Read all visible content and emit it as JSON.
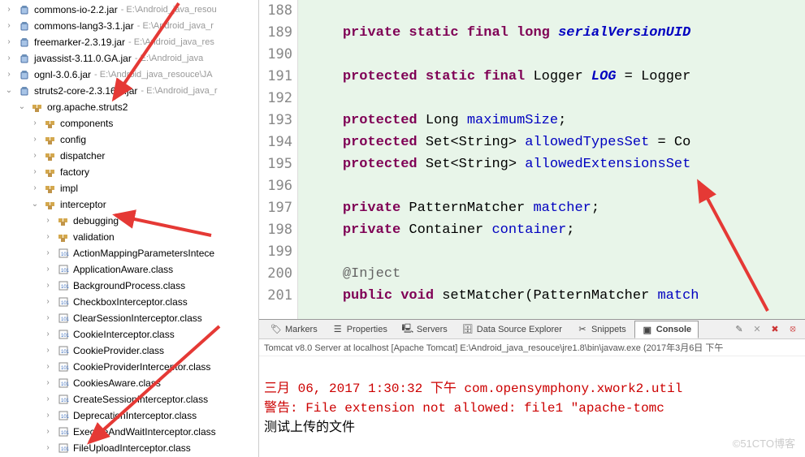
{
  "explorer": {
    "jars": [
      {
        "name": "commons-io-2.2.jar",
        "path": "E:\\Android_java_resou"
      },
      {
        "name": "commons-lang3-3.1.jar",
        "path": "E:\\Android_java_r"
      },
      {
        "name": "freemarker-2.3.19.jar",
        "path": "E:\\Android_java_res"
      },
      {
        "name": "javassist-3.11.0.GA.jar",
        "path": "E:\\Android_java"
      },
      {
        "name": "ognl-3.0.6.jar",
        "path": "E:\\Android_java_resouce\\JA"
      }
    ],
    "expandedJar": {
      "name": "struts2-core-2.3.16.3.jar",
      "path": "E:\\Android_java_r"
    },
    "rootPkg": "org.apache.struts2",
    "subPkgs": [
      "components",
      "config",
      "dispatcher",
      "factory",
      "impl"
    ],
    "openPkg": "interceptor",
    "innerPkgs": [
      "debugging",
      "validation"
    ],
    "classes": [
      "ActionMappingParametersIntece",
      "ApplicationAware.class",
      "BackgroundProcess.class",
      "CheckboxInterceptor.class",
      "ClearSessionInterceptor.class",
      "CookieInterceptor.class",
      "CookieProvider.class",
      "CookieProviderInterceptor.class",
      "CookiesAware.class",
      "CreateSessionInterceptor.class",
      "DeprecationInterceptor.class",
      "ExecuteAndWaitInterceptor.class",
      "FileUploadInterceptor.class"
    ]
  },
  "editor": {
    "lineStart": 188,
    "lines": [
      "",
      "    <kw>private static final long</kw> <fld-s>serialVersionUID</fld-s>",
      "",
      "    <kw>protected static final</kw> Logger <fld-s>LOG</fld-s> = Logger",
      "",
      "    <kw>protected</kw> Long <fld>maximumSize</fld>;",
      "    <kw>protected</kw> Set<String> <fld>allowedTypesSet</fld> = Co",
      "    <kw>protected</kw> Set<String> <fld>allowedExtensionsSet</fld>",
      "",
      "    <kw>private</kw> PatternMatcher <fld>matcher</fld>;",
      "    <kw>private</kw> Container <fld>container</fld>;",
      "",
      "    <ann>@Inject</ann>",
      "    <kw>public void</kw> setMatcher(PatternMatcher <fld>match</fld>"
    ]
  },
  "tabs": {
    "items": [
      {
        "icon": "🏷",
        "label": "Markers"
      },
      {
        "icon": "☰",
        "label": "Properties"
      },
      {
        "icon": "🖳",
        "label": "Servers"
      },
      {
        "icon": "🗄",
        "label": "Data Source Explorer"
      },
      {
        "icon": "✂",
        "label": "Snippets"
      },
      {
        "icon": "▣",
        "label": "Console",
        "active": true
      }
    ]
  },
  "statusLine": "Tomcat v8.0 Server at localhost [Apache Tomcat] E:\\Android_java_resouce\\jre1.8\\bin\\javaw.exe (2017年3月6日 下午",
  "console": {
    "line1": "三月 06, 2017 1:30:32 下午 com.opensymphony.xwork2.util",
    "line2": "警告: File extension not allowed: file1 \"apache-tomc",
    "line3": "测试上传的文件"
  },
  "watermark": "©51CTO博客"
}
